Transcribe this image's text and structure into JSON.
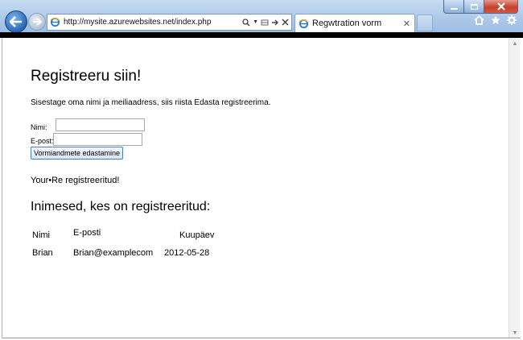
{
  "browser": {
    "url": "http://mysite.azurewebsites.net/index.php",
    "tab_title": "Regwtration vorm",
    "tab_close": "✕"
  },
  "page": {
    "title": "Registreeru siin!",
    "intro": "Sisestage oma nimi ja meiliaadress, siis riista Edasta registreerima.",
    "form": {
      "name_label": "Nimi:",
      "name_value": "",
      "email_label": "E-post:",
      "email_value": "",
      "submit_label": "Vormiandmete edastamine"
    },
    "success_message": "Your•Re registreeritud!",
    "list_title": "Inimesed, kes on registreeritud:",
    "table": {
      "headers": [
        "Nimi",
        "E-posti",
        "Kuupäev"
      ],
      "rows": [
        [
          "Brian",
          "Brian@examplecom",
          "2012-05-28"
        ]
      ]
    }
  },
  "icons": [
    "back-arrow-icon",
    "forward-arrow-icon",
    "ie-logo-icon",
    "search-icon",
    "compatibility-icon",
    "refresh-icon",
    "stop-icon",
    "home-icon",
    "favorites-star-icon",
    "tools-gear-icon"
  ],
  "colors": {
    "accent": "#2a66b8",
    "chrome": "#a9c6e8",
    "close": "#c4402c"
  }
}
